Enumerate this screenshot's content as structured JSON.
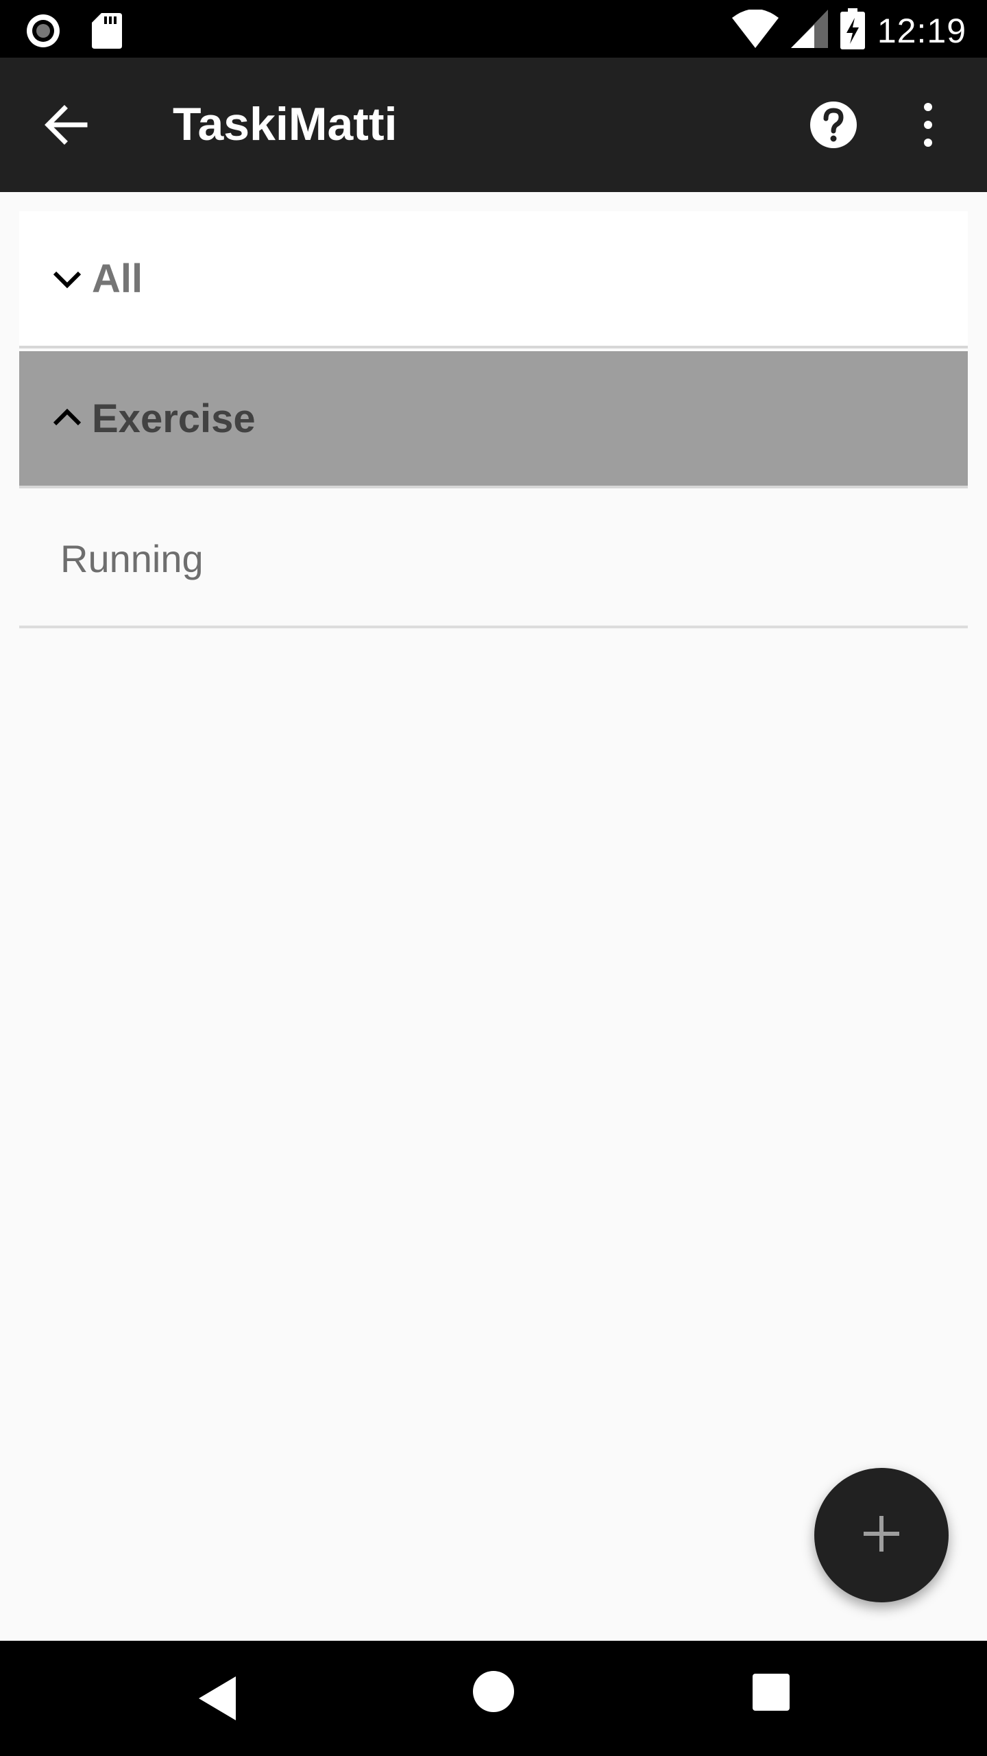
{
  "status_bar": {
    "time": "12:19",
    "icons": [
      "record-icon",
      "sd-card-icon",
      "wifi-icon",
      "signal-icon",
      "battery-charging-icon"
    ]
  },
  "app_bar": {
    "title": "TaskiMatti",
    "icons": [
      "back-arrow-icon",
      "help-icon",
      "more-vert-icon"
    ]
  },
  "list": {
    "groups": [
      {
        "label": "All",
        "expanded": false,
        "icon": "chevron-down-icon"
      },
      {
        "label": "Exercise",
        "expanded": true,
        "icon": "chevron-up-icon",
        "children": [
          {
            "label": "Running"
          }
        ]
      }
    ]
  },
  "fab": {
    "icon": "plus-icon"
  },
  "colors": {
    "app_bar": "#212121",
    "background": "#fafafa",
    "selected_group": "#9e9e9e",
    "fab": "#212121"
  }
}
